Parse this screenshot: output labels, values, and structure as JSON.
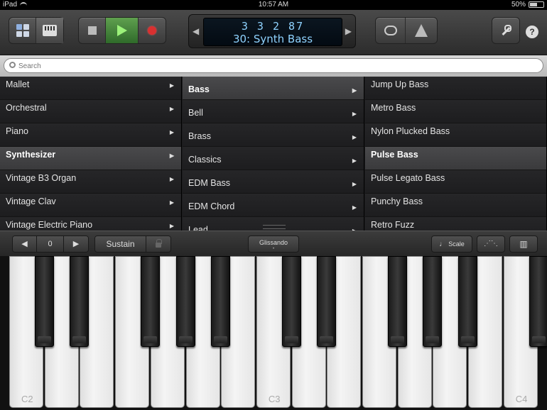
{
  "status_bar": {
    "device": "iPad",
    "time": "10:57 AM",
    "battery": "50%",
    "battery_level": 0.5
  },
  "toolbar": {
    "lcd_position": "3 3 2  87",
    "lcd_instrument": "30: Synth Bass",
    "help_label": "?"
  },
  "search": {
    "placeholder": "Search",
    "value": ""
  },
  "browser": {
    "categories": [
      {
        "label": "Mallet",
        "selected": false
      },
      {
        "label": "Orchestral",
        "selected": false
      },
      {
        "label": "Piano",
        "selected": false
      },
      {
        "label": "Synthesizer",
        "selected": true
      },
      {
        "label": "Vintage B3 Organ",
        "selected": false
      },
      {
        "label": "Vintage Clav",
        "selected": false
      },
      {
        "label": "Vintage Electric Piano",
        "selected": false
      }
    ],
    "subcategories": [
      {
        "label": "Bass",
        "selected": true
      },
      {
        "label": "Bell",
        "selected": false
      },
      {
        "label": "Brass",
        "selected": false
      },
      {
        "label": "Classics",
        "selected": false
      },
      {
        "label": "EDM Bass",
        "selected": false
      },
      {
        "label": "EDM Chord",
        "selected": false
      },
      {
        "label": "Lead",
        "selected": false
      }
    ],
    "patches": [
      {
        "label": "Jump Up Bass",
        "selected": false
      },
      {
        "label": "Metro Bass",
        "selected": false
      },
      {
        "label": "Nylon Plucked Bass",
        "selected": false
      },
      {
        "label": "Pulse Bass",
        "selected": true
      },
      {
        "label": "Pulse Legato Bass",
        "selected": false
      },
      {
        "label": "Punchy Bass",
        "selected": false
      },
      {
        "label": "Retro Fuzz",
        "selected": false
      }
    ]
  },
  "keyboard_controls": {
    "octave_value": "0",
    "sustain_label": "Sustain",
    "glissando_label": "Glissando",
    "scale_label": "Scale"
  },
  "keyboard": {
    "labels": {
      "c2": "C2",
      "c3": "C3",
      "c4": "C4"
    }
  }
}
